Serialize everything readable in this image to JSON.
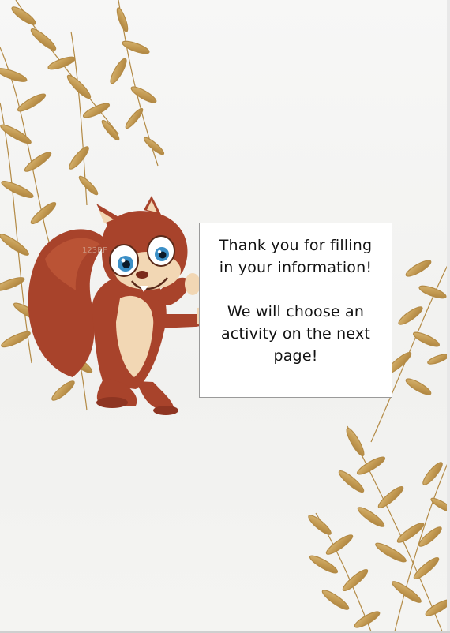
{
  "message": {
    "line1": "Thank you for filling",
    "line2": "in your information!",
    "line3": "We will choose an",
    "line4": "activity on the next",
    "line5": "page!"
  },
  "colors": {
    "background": "#f3f3f1",
    "leaf_gold": "#c9a15a",
    "card_border": "#9a9a9a",
    "squirrel_fur": "#a8432b",
    "squirrel_belly": "#f2d7b4",
    "squirrel_eyes": "#3b8fc7"
  },
  "icons": {
    "decor_top_left": "golden-leaf-branch-icon",
    "decor_bottom_right": "golden-leaf-branch-icon",
    "character": "squirrel-mascot-icon"
  },
  "watermark": "123RF"
}
